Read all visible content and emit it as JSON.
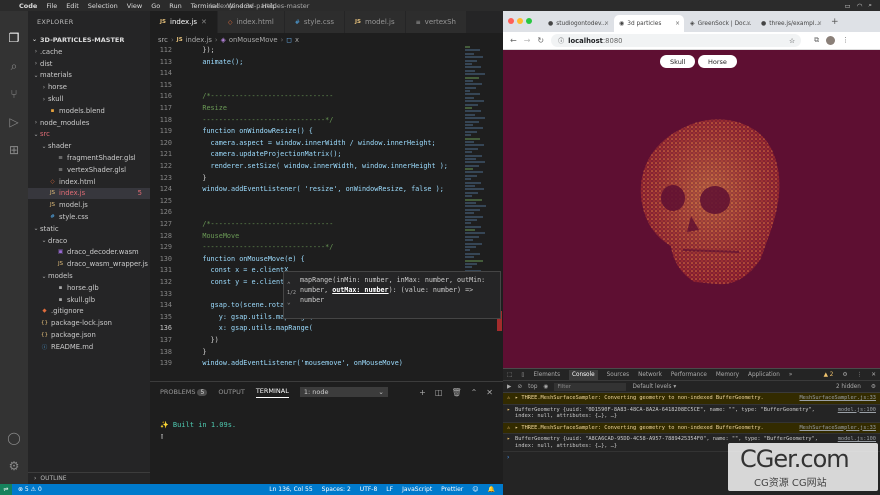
{
  "menubar": {
    "app": "Code",
    "items": [
      "File",
      "Edit",
      "Selection",
      "View",
      "Go",
      "Run",
      "Terminal",
      "Window",
      "Help"
    ],
    "window_title": "index.js — 3d-particles-master"
  },
  "explorer": {
    "title": "EXPLORER",
    "project": "3D-PARTICLES-MASTER",
    "rows": [
      {
        "label": ".cache",
        "indent": 1,
        "tw": "›",
        "icon": "",
        "ic": "#aaa"
      },
      {
        "label": "dist",
        "indent": 1,
        "tw": "›",
        "icon": "",
        "ic": "#aaa"
      },
      {
        "label": "materials",
        "indent": 1,
        "tw": "⌄",
        "icon": "",
        "ic": "#aaa"
      },
      {
        "label": "horse",
        "indent": 2,
        "tw": "›",
        "icon": "",
        "ic": "#aaa"
      },
      {
        "label": "skull",
        "indent": 2,
        "tw": "›",
        "icon": "",
        "ic": "#aaa"
      },
      {
        "label": "models.blend",
        "indent": 2,
        "tw": "",
        "icon": "▪",
        "ic": "#e8a33d"
      },
      {
        "label": "node_modules",
        "indent": 1,
        "tw": "›",
        "icon": "",
        "ic": "#aaa"
      },
      {
        "label": "src",
        "indent": 1,
        "tw": "⌄",
        "icon": "",
        "ic": "#aaa",
        "color": "#e06c75"
      },
      {
        "label": "shader",
        "indent": 2,
        "tw": "⌄",
        "icon": "",
        "ic": "#aaa"
      },
      {
        "label": "fragmentShader.glsl",
        "indent": 3,
        "tw": "",
        "icon": "≡",
        "ic": "#aaa"
      },
      {
        "label": "vertexShader.glsl",
        "indent": 3,
        "tw": "",
        "icon": "≡",
        "ic": "#aaa"
      },
      {
        "label": "index.html",
        "indent": 2,
        "tw": "",
        "icon": "◇",
        "ic": "#e06c3c"
      },
      {
        "label": "index.js",
        "indent": 2,
        "tw": "",
        "icon": "JS",
        "ic": "#e5c07b",
        "color": "#e06c75",
        "sel": true,
        "badge": "5"
      },
      {
        "label": "model.js",
        "indent": 2,
        "tw": "",
        "icon": "JS",
        "ic": "#e5c07b"
      },
      {
        "label": "style.css",
        "indent": 2,
        "tw": "",
        "icon": "#",
        "ic": "#4fa3e0"
      },
      {
        "label": "static",
        "indent": 1,
        "tw": "⌄",
        "icon": "",
        "ic": "#aaa"
      },
      {
        "label": "draco",
        "indent": 2,
        "tw": "⌄",
        "icon": "",
        "ic": "#aaa"
      },
      {
        "label": "draco_decoder.wasm",
        "indent": 3,
        "tw": "",
        "icon": "▣",
        "ic": "#9b6bd6"
      },
      {
        "label": "draco_wasm_wrapper.js",
        "indent": 3,
        "tw": "",
        "icon": "JS",
        "ic": "#e5c07b"
      },
      {
        "label": "models",
        "indent": 2,
        "tw": "⌄",
        "icon": "",
        "ic": "#aaa"
      },
      {
        "label": "horse.glb",
        "indent": 3,
        "tw": "",
        "icon": "▪",
        "ic": "#aaa"
      },
      {
        "label": "skull.glb",
        "indent": 3,
        "tw": "",
        "icon": "▪",
        "ic": "#aaa"
      },
      {
        "label": ".gitignore",
        "indent": 1,
        "tw": "",
        "icon": "◆",
        "ic": "#e06c3c"
      },
      {
        "label": "package-lock.json",
        "indent": 1,
        "tw": "",
        "icon": "{}",
        "ic": "#e5c07b"
      },
      {
        "label": "package.json",
        "indent": 1,
        "tw": "",
        "icon": "{}",
        "ic": "#e5c07b"
      },
      {
        "label": "README.md",
        "indent": 1,
        "tw": "",
        "icon": "ⓘ",
        "ic": "#4fa3e0"
      }
    ],
    "outline": "OUTLINE"
  },
  "tabs": [
    {
      "label": "index.js",
      "kind": "js",
      "active": true
    },
    {
      "label": "index.html",
      "kind": "html"
    },
    {
      "label": "style.css",
      "kind": "css"
    },
    {
      "label": "model.js",
      "kind": "js"
    },
    {
      "label": "vertexSh",
      "kind": "glsl"
    }
  ],
  "breadcrumb": {
    "folder": "src",
    "file": "index.js",
    "symbol": "onMouseMove",
    "param": "x"
  },
  "code": [
    {
      "n": "112",
      "t": "    });"
    },
    {
      "n": "113",
      "t": "    animate();"
    },
    {
      "n": "114",
      "t": ""
    },
    {
      "n": "115",
      "t": ""
    },
    {
      "n": "116",
      "t": "    /*------------------------------",
      "c": "#6a9955"
    },
    {
      "n": "117",
      "t": "    Resize",
      "c": "#6a9955"
    },
    {
      "n": "118",
      "t": "    ------------------------------*/",
      "c": "#6a9955"
    },
    {
      "n": "119",
      "t": "    function onWindowResize() {"
    },
    {
      "n": "120",
      "t": "      camera.aspect = window.innerWidth / window.innerHeight;"
    },
    {
      "n": "121",
      "t": "      camera.updateProjectionMatrix();"
    },
    {
      "n": "122",
      "t": "      renderer.setSize( window.innerWidth, window.innerHeight );"
    },
    {
      "n": "123",
      "t": "    }"
    },
    {
      "n": "124",
      "t": "    window.addEventListener( 'resize', onWindowResize, false );"
    },
    {
      "n": "125",
      "t": ""
    },
    {
      "n": "126",
      "t": ""
    },
    {
      "n": "127",
      "t": "    /*------------------------------",
      "c": "#6a9955"
    },
    {
      "n": "128",
      "t": "    MouseMove",
      "c": "#6a9955"
    },
    {
      "n": "129",
      "t": "    ------------------------------*/",
      "c": "#6a9955"
    },
    {
      "n": "130",
      "t": "    function onMouseMove(e) {"
    },
    {
      "n": "131",
      "t": "      const x = e.clientX"
    },
    {
      "n": "132",
      "t": "      const y = e.clientY"
    },
    {
      "n": "133",
      "t": ""
    },
    {
      "n": "134",
      "t": "      gsap.to(scene.rotation, {"
    },
    {
      "n": "135",
      "t": "        y: gsap.utils.mapRange("
    },
    {
      "n": "136",
      "t": "        x: gsap.utils.mapRange("
    },
    {
      "n": "137",
      "t": "      })"
    },
    {
      "n": "138",
      "t": "    }"
    },
    {
      "n": "139",
      "t": "    window.addEventListener('mousemove', onMouseMove)"
    }
  ],
  "hint": {
    "counter": "1/2",
    "pre": "mapRange(inMin: number, inMax: number, outMin: number, ",
    "bold": "outMax: number",
    "post": "): (value: number) => number"
  },
  "panel": {
    "tabs": [
      "PROBLEMS",
      "OUTPUT",
      "TERMINAL"
    ],
    "problems_count": "5",
    "terminal_select": "1: node",
    "line1": "✨  Built in 1.09s.",
    "line2": "▯"
  },
  "status": {
    "errors": "⊗ 5 ⚠ 0",
    "right": [
      "Ln 136, Col 55",
      "Spaces: 2",
      "UTF-8",
      "LF",
      "JavaScript",
      "Prettier",
      "☺",
      "🔔"
    ]
  },
  "browser": {
    "tabs": [
      {
        "label": "studiogontodev...",
        "fav": "●"
      },
      {
        "label": "3d particles",
        "fav": "◉",
        "active": true
      },
      {
        "label": "GreenSock | Doc...",
        "fav": "◈"
      },
      {
        "label": "three.js/exampl...",
        "fav": "●"
      }
    ],
    "url_host": "localhost",
    "url_port": ":8080",
    "buttons": [
      "Skull",
      "Horse"
    ],
    "accent": "#5e0f32",
    "particle_color": "#e8743b"
  },
  "devtools": {
    "tabs": [
      "Elements",
      "Console",
      "Sources",
      "Network",
      "Performance",
      "Memory",
      "Application",
      "»"
    ],
    "warnings": "▲ 2",
    "context": "top",
    "filter_placeholder": "Filter",
    "levels": "Default levels ▾",
    "hidden": "2 hidden",
    "messages": [
      {
        "kind": "warn",
        "text": "▸ THREE.MeshSurfaceSampler: Converting geometry to non-indexed BufferGeometry.",
        "src": "MeshSurfaceSampler.js:33"
      },
      {
        "kind": "log",
        "text": "BufferGeometry {uuid: \"0D1590F-8A83-48CA-8A2A-6418208EC5CE\", name: \"\", type: \"BufferGeometry\", index: null, attributes: {…}, …}",
        "src": "model.js:100"
      },
      {
        "kind": "warn",
        "text": "▸ THREE.MeshSurfaceSampler: Converting geometry to non-indexed BufferGeometry.",
        "src": "MeshSurfaceSampler.js:33"
      },
      {
        "kind": "log",
        "text": "BufferGeometry {uuid: \"A8CA6CAD-95DD-4C58-A957-7889425354F0\", name: \"\", type: \"BufferGeometry\", index: null, attributes: {…}, …}",
        "src": "model.js:100"
      }
    ]
  },
  "watermark": {
    "big": "CGer.com",
    "small": "CG资源 CG网站"
  }
}
